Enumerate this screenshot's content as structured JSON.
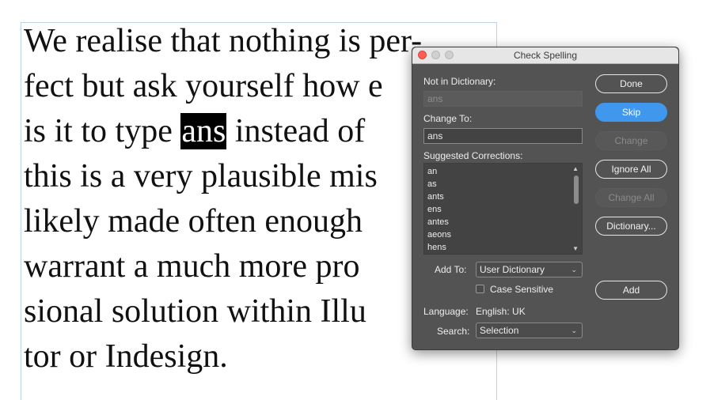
{
  "document": {
    "lines": [
      "We realise that nothing is per-",
      "fect but ask yourself how e",
      "is it to type",
      "this is a very plausible mis",
      "likely made often enough",
      "warrant a much more pro",
      "sional solution within Illu",
      "tor or Indesign."
    ],
    "highlighted_word": "ans",
    "line3_after": "instead of"
  },
  "dialog": {
    "title": "Check Spelling",
    "not_in_dictionary_label": "Not in Dictionary:",
    "not_in_dictionary_value": "ans",
    "change_to_label": "Change To:",
    "change_to_value": "ans",
    "suggested_label": "Suggested Corrections:",
    "suggestions": [
      "an",
      "as",
      "ants",
      "ens",
      "antes",
      "aeons",
      "hens"
    ],
    "add_to_label": "Add To:",
    "add_to_value": "User Dictionary",
    "case_sensitive_label": "Case Sensitive",
    "language_label": "Language:",
    "language_value": "English: UK",
    "search_label": "Search:",
    "search_value": "Selection",
    "buttons": {
      "done": "Done",
      "skip": "Skip",
      "change": "Change",
      "ignore_all": "Ignore All",
      "change_all": "Change All",
      "dictionary": "Dictionary...",
      "add": "Add"
    }
  },
  "colors": {
    "accent": "#3f98ee",
    "dialog_bg": "#535353",
    "close_light": "#fd5f57"
  }
}
